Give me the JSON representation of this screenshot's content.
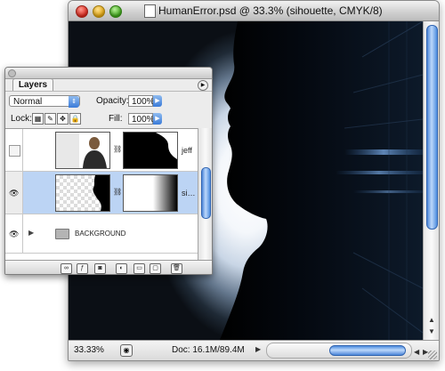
{
  "document": {
    "title": "HumanError.psd @ 33.3% (sihouette, CMYK/8)",
    "zoom": "33.33%",
    "doc_size": "Doc: 16.1M/89.4M"
  },
  "layers_panel": {
    "tab_label": "Layers",
    "blend_mode": "Normal",
    "opacity_label": "Opacity:",
    "opacity_value": "100%",
    "lock_label": "Lock:",
    "fill_label": "Fill:",
    "fill_value": "100%",
    "layers": [
      {
        "name": "jeff",
        "visible": false,
        "selected": false
      },
      {
        "name": "si…",
        "visible": true,
        "selected": true
      },
      {
        "name": "BACKGROUND",
        "visible": true,
        "selected": false,
        "is_group": true
      }
    ]
  },
  "colors": {
    "selection": "#bcd4f4",
    "accent": "#3a7bd8",
    "silhouette": "#000000"
  },
  "icons": [
    "folder-icon",
    "chain-icon",
    "eye-icon",
    "link-layers-icon",
    "layer-style-icon",
    "mask-icon",
    "adjustment-icon",
    "new-group-icon",
    "new-layer-icon",
    "trash-icon"
  ]
}
